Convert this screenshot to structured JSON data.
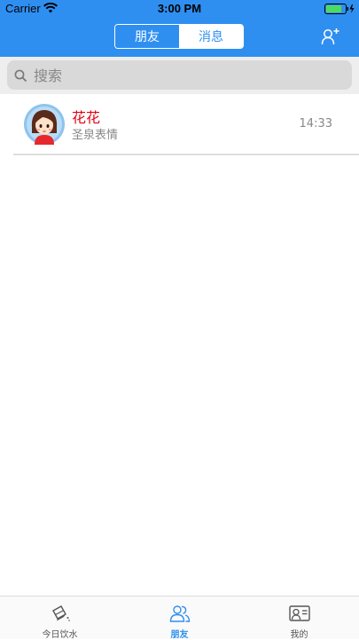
{
  "status_bar": {
    "carrier": "Carrier",
    "time": "3:00 PM",
    "battery_color": "#4cd964"
  },
  "header": {
    "background": "#2f8ff0",
    "tabs": [
      {
        "label": "朋友",
        "selected": true
      },
      {
        "label": "消息",
        "selected": false
      }
    ],
    "add_icon": "add-user-icon"
  },
  "search": {
    "placeholder": "搜索",
    "value": ""
  },
  "conversations": [
    {
      "name": "花花",
      "preview": "圣泉表情",
      "time": "14:33",
      "avatar": "girl-avatar"
    }
  ],
  "tab_bar": {
    "items": [
      {
        "label": "今日饮水",
        "icon": "water-cup-icon",
        "active": false
      },
      {
        "label": "朋友",
        "icon": "friends-icon",
        "active": true
      },
      {
        "label": "我的",
        "icon": "profile-card-icon",
        "active": false
      }
    ]
  },
  "colors": {
    "accent": "#2f8ff0",
    "name_red": "#e60012"
  }
}
